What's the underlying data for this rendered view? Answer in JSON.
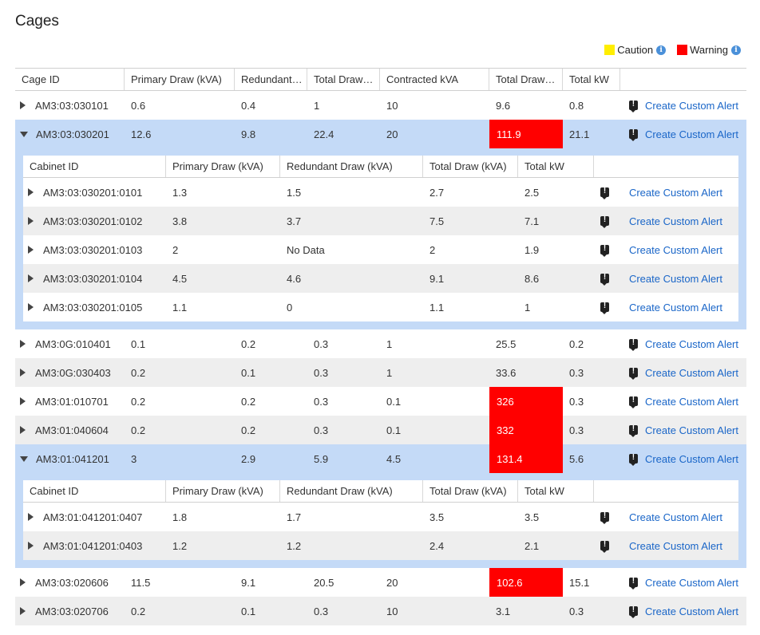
{
  "page": {
    "title": "Cages"
  },
  "legend": [
    {
      "label": "Caution",
      "color": "#ffee00"
    },
    {
      "label": "Warning",
      "color": "#ff0000"
    }
  ],
  "colors": {
    "warning": "#ff0000",
    "expanded_row": "#c4daf7",
    "link": "#1a66c8"
  },
  "cage_columns": [
    "Cage ID",
    "Primary Draw (kVA)",
    "Redundant…",
    "Total Draw…",
    "Contracted kVA",
    "Total Draw…",
    "Total kW",
    ""
  ],
  "cabinet_columns": [
    "Cabinet ID",
    "Primary Draw (kVA)",
    "Redundant Draw (kVA)",
    "Total Draw (kVA)",
    "Total kW",
    ""
  ],
  "alert_link_label": "Create Custom Alert",
  "alert_icon": "alert-flag-icon",
  "cages": [
    {
      "id": "AM3:03:030101",
      "primary": "0.6",
      "redundant": "0.4",
      "total": "1",
      "contracted": "10",
      "total_pct": "9.6",
      "total_kw": "0.8",
      "warning": false,
      "expanded": false,
      "cabinets": []
    },
    {
      "id": "AM3:03:030201",
      "primary": "12.6",
      "redundant": "9.8",
      "total": "22.4",
      "contracted": "20",
      "total_pct": "111.9",
      "total_kw": "21.1",
      "warning": true,
      "expanded": true,
      "cabinets": [
        {
          "id": "AM3:03:030201:0101",
          "primary": "1.3",
          "redundant": "1.5",
          "total": "2.7",
          "total_kw": "2.5"
        },
        {
          "id": "AM3:03:030201:0102",
          "primary": "3.8",
          "redundant": "3.7",
          "total": "7.5",
          "total_kw": "7.1"
        },
        {
          "id": "AM3:03:030201:0103",
          "primary": "2",
          "redundant": "No Data",
          "total": "2",
          "total_kw": "1.9"
        },
        {
          "id": "AM3:03:030201:0104",
          "primary": "4.5",
          "redundant": "4.6",
          "total": "9.1",
          "total_kw": "8.6"
        },
        {
          "id": "AM3:03:030201:0105",
          "primary": "1.1",
          "redundant": "0",
          "total": "1.1",
          "total_kw": "1"
        }
      ]
    },
    {
      "id": "AM3:0G:010401",
      "primary": "0.1",
      "redundant": "0.2",
      "total": "0.3",
      "contracted": "1",
      "total_pct": "25.5",
      "total_kw": "0.2",
      "warning": false,
      "expanded": false,
      "cabinets": []
    },
    {
      "id": "AM3:0G:030403",
      "primary": "0.2",
      "redundant": "0.1",
      "total": "0.3",
      "contracted": "1",
      "total_pct": "33.6",
      "total_kw": "0.3",
      "warning": false,
      "expanded": false,
      "cabinets": []
    },
    {
      "id": "AM3:01:010701",
      "primary": "0.2",
      "redundant": "0.2",
      "total": "0.3",
      "contracted": "0.1",
      "total_pct": "326",
      "total_kw": "0.3",
      "warning": true,
      "expanded": false,
      "cabinets": []
    },
    {
      "id": "AM3:01:040604",
      "primary": "0.2",
      "redundant": "0.2",
      "total": "0.3",
      "contracted": "0.1",
      "total_pct": "332",
      "total_kw": "0.3",
      "warning": true,
      "expanded": false,
      "cabinets": []
    },
    {
      "id": "AM3:01:041201",
      "primary": "3",
      "redundant": "2.9",
      "total": "5.9",
      "contracted": "4.5",
      "total_pct": "131.4",
      "total_kw": "5.6",
      "warning": true,
      "expanded": true,
      "cabinets": [
        {
          "id": "AM3:01:041201:0407",
          "primary": "1.8",
          "redundant": "1.7",
          "total": "3.5",
          "total_kw": "3.5"
        },
        {
          "id": "AM3:01:041201:0403",
          "primary": "1.2",
          "redundant": "1.2",
          "total": "2.4",
          "total_kw": "2.1"
        }
      ]
    },
    {
      "id": "AM3:03:020606",
      "primary": "11.5",
      "redundant": "9.1",
      "total": "20.5",
      "contracted": "20",
      "total_pct": "102.6",
      "total_kw": "15.1",
      "warning": true,
      "expanded": false,
      "cabinets": []
    },
    {
      "id": "AM3:03:020706",
      "primary": "0.2",
      "redundant": "0.1",
      "total": "0.3",
      "contracted": "10",
      "total_pct": "3.1",
      "total_kw": "0.3",
      "warning": false,
      "expanded": false,
      "cabinets": []
    }
  ]
}
